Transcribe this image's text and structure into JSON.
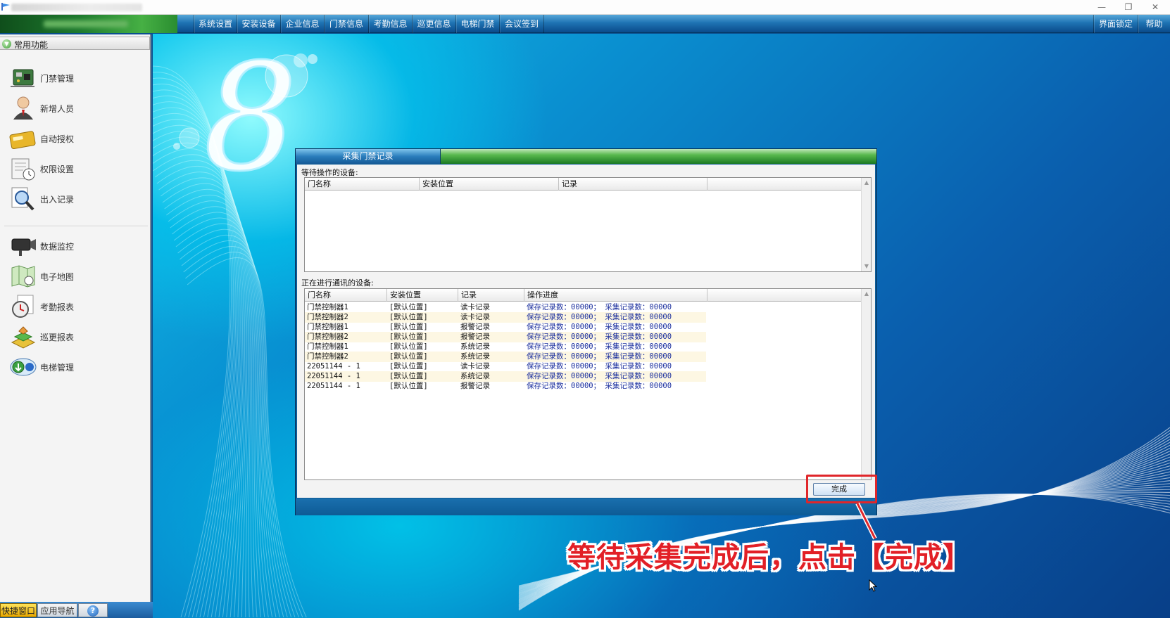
{
  "window": {
    "buttons": {
      "minimize": "—",
      "maximize": "❐",
      "close": "✕"
    }
  },
  "menubar": {
    "items": [
      "系统设置",
      "安装设备",
      "企业信息",
      "门禁信息",
      "考勤信息",
      "巡更信息",
      "电梯门禁",
      "会议签到"
    ],
    "right_items": [
      "界面锁定",
      "帮助"
    ]
  },
  "sidebar": {
    "header": "常用功能",
    "items": [
      {
        "label": "门禁管理",
        "icon": "circuit-board-icon"
      },
      {
        "label": "新增人员",
        "icon": "person-icon"
      },
      {
        "label": "自动授权",
        "icon": "card-icon"
      },
      {
        "label": "权限设置",
        "icon": "permission-clock-icon"
      },
      {
        "label": "出入记录",
        "icon": "magnifier-record-icon"
      },
      {
        "label": "数据监控",
        "icon": "camera-icon"
      },
      {
        "label": "电子地图",
        "icon": "map-icon"
      },
      {
        "label": "考勤报表",
        "icon": "clock-report-icon"
      },
      {
        "label": "巡更报表",
        "icon": "patrol-icon"
      },
      {
        "label": "电梯管理",
        "icon": "elevator-icon"
      }
    ],
    "bottom_tabs": [
      "快捷窗口",
      "应用导航"
    ],
    "help_icon": "?"
  },
  "dialog": {
    "title": "采集门禁记录",
    "waiting_label": "等待操作的设备:",
    "waiting_columns": [
      "门名称",
      "安装位置",
      "记录"
    ],
    "active_label": "正在进行通讯的设备:",
    "active_columns": [
      "门名称",
      "安装位置",
      "记录",
      "操作进度"
    ],
    "active_rows": [
      [
        "门禁控制器1",
        "[默认位置]",
        "读卡记录",
        "保存记录数：00000； 采集记录数：00000"
      ],
      [
        "门禁控制器2",
        "[默认位置]",
        "读卡记录",
        "保存记录数：00000； 采集记录数：00000"
      ],
      [
        "门禁控制器1",
        "[默认位置]",
        "报警记录",
        "保存记录数：00000； 采集记录数：00000"
      ],
      [
        "门禁控制器2",
        "[默认位置]",
        "报警记录",
        "保存记录数：00000； 采集记录数：00000"
      ],
      [
        "门禁控制器1",
        "[默认位置]",
        "系统记录",
        "保存记录数：00000； 采集记录数：00000"
      ],
      [
        "门禁控制器2",
        "[默认位置]",
        "系统记录",
        "保存记录数：00000； 采集记录数：00000"
      ],
      [
        "22051144 - 1",
        "[默认位置]",
        "读卡记录",
        "保存记录数：00000； 采集记录数：00000"
      ],
      [
        "22051144 - 1",
        "[默认位置]",
        "系统记录",
        "保存记录数：00000； 采集记录数：00000"
      ],
      [
        "22051144 - 1",
        "[默认位置]",
        "报警记录",
        "保存记录数：00000； 采集记录数：00000"
      ]
    ],
    "done_button": "完成"
  },
  "annotation": "等待采集完成后，点击【完成】",
  "colors": {
    "accent_green": "#1e7a2e",
    "menubar_blue": "#1f74b4",
    "annotation_red": "#e21f26",
    "progress_text": "#1b2f9e"
  }
}
